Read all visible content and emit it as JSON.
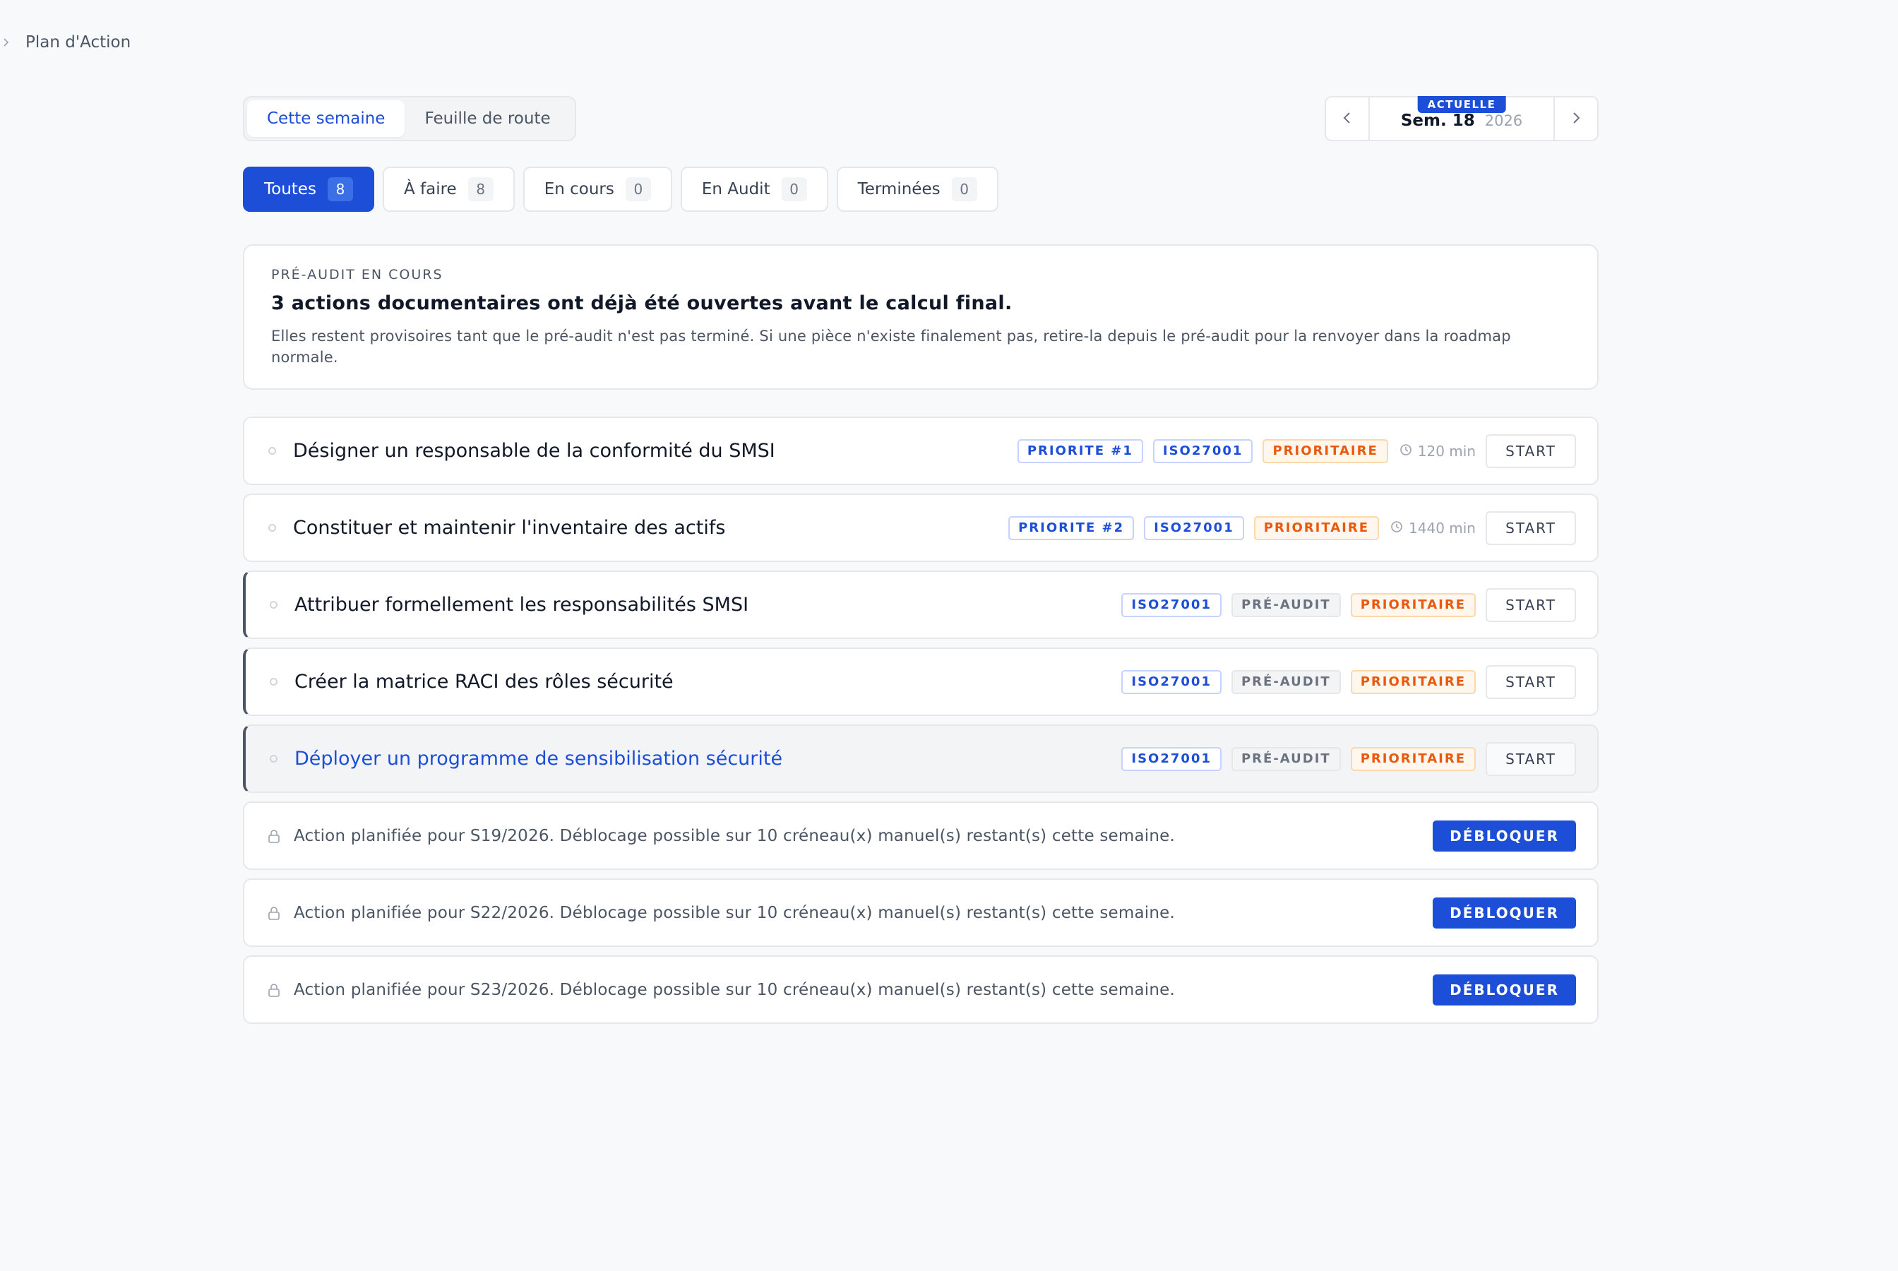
{
  "breadcrumb": {
    "current": "Plan d'Action"
  },
  "view_tabs": [
    {
      "label": "Cette semaine",
      "active": true
    },
    {
      "label": "Feuille de route",
      "active": false
    }
  ],
  "week_nav": {
    "badge": "ACTUELLE",
    "week": "Sem. 18",
    "year": "2026"
  },
  "filters": [
    {
      "label": "Toutes",
      "count": "8",
      "active": true
    },
    {
      "label": "À faire",
      "count": "8",
      "active": false
    },
    {
      "label": "En cours",
      "count": "0",
      "active": false
    },
    {
      "label": "En Audit",
      "count": "0",
      "active": false
    },
    {
      "label": "Terminées",
      "count": "0",
      "active": false
    }
  ],
  "info": {
    "eyebrow": "PRÉ-AUDIT EN COURS",
    "title": "3 actions documentaires ont déjà été ouvertes avant le calcul final.",
    "text": "Elles restent provisoires tant que le pré-audit n'est pas terminé. Si une pièce n'existe finalement pas, retire-la depuis le pré-audit pour la renvoyer dans la roadmap normale."
  },
  "tasks": [
    {
      "title": "Désigner un responsable de la conformité du SMSI",
      "priority": "PRIORITE #1",
      "framework": "ISO27001",
      "status": "PRIORITAIRE",
      "duration": "120 min",
      "action": "START"
    },
    {
      "title": "Constituer et maintenir l'inventaire des actifs",
      "priority": "PRIORITE #2",
      "framework": "ISO27001",
      "status": "PRIORITAIRE",
      "duration": "1440 min",
      "action": "START"
    },
    {
      "title": "Attribuer formellement les responsabilités SMSI",
      "framework": "ISO27001",
      "pre_audit": "PRÉ-AUDIT",
      "status": "PRIORITAIRE",
      "action": "START"
    },
    {
      "title": "Créer la matrice RACI des rôles sécurité",
      "framework": "ISO27001",
      "pre_audit": "PRÉ-AUDIT",
      "status": "PRIORITAIRE",
      "action": "START"
    },
    {
      "title": "Déployer un programme de sensibilisation sécurité",
      "framework": "ISO27001",
      "pre_audit": "PRÉ-AUDIT",
      "status": "PRIORITAIRE",
      "action": "START"
    }
  ],
  "locked": [
    {
      "text": "Action planifiée pour S19/2026. Déblocage possible sur 10 créneau(x) manuel(s) restant(s) cette semaine.",
      "action": "DÉBLOQUER"
    },
    {
      "text": "Action planifiée pour S22/2026. Déblocage possible sur 10 créneau(x) manuel(s) restant(s) cette semaine.",
      "action": "DÉBLOQUER"
    },
    {
      "text": "Action planifiée pour S23/2026. Déblocage possible sur 10 créneau(x) manuel(s) restant(s) cette semaine.",
      "action": "DÉBLOQUER"
    }
  ],
  "colors": {
    "accent": "#1d4ed8",
    "warning": "#ea580c",
    "muted": "#6b7280"
  }
}
